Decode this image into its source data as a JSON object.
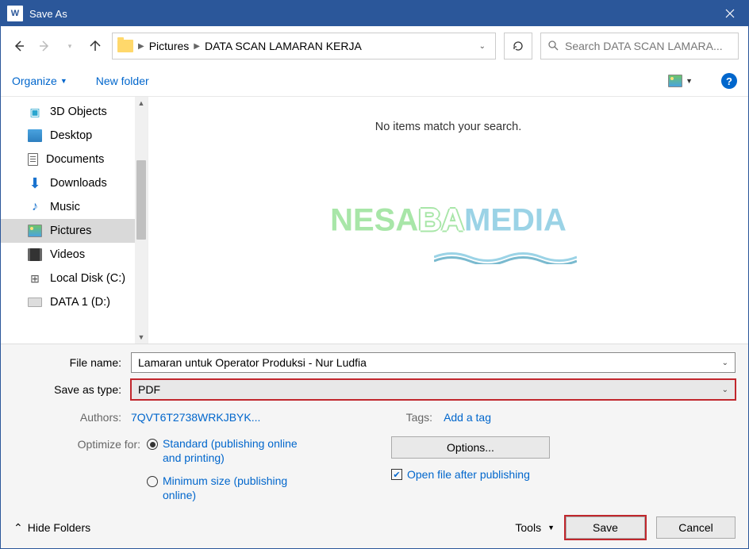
{
  "title": "Save As",
  "breadcrumbs": {
    "root": "Pictures",
    "current": "DATA SCAN LAMARAN KERJA"
  },
  "search": {
    "placeholder": "Search DATA SCAN LAMARA..."
  },
  "toolbar": {
    "organize": "Organize",
    "newfolder": "New folder"
  },
  "sidebar": {
    "items": [
      {
        "label": "3D Objects"
      },
      {
        "label": "Desktop"
      },
      {
        "label": "Documents"
      },
      {
        "label": "Downloads"
      },
      {
        "label": "Music"
      },
      {
        "label": "Pictures"
      },
      {
        "label": "Videos"
      },
      {
        "label": "Local Disk (C:)"
      },
      {
        "label": "DATA 1 (D:)"
      }
    ]
  },
  "filearea": {
    "empty_msg": "No items match your search."
  },
  "form": {
    "filename_label": "File name:",
    "filename_value": "Lamaran untuk Operator Produksi - Nur Ludfia",
    "savetype_label": "Save as type:",
    "savetype_value": "PDF",
    "authors_label": "Authors:",
    "authors_value": "7QVT6T2738WRKJBYK...",
    "tags_label": "Tags:",
    "tags_value": "Add a tag",
    "optimize_label": "Optimize for:",
    "opt_standard": "Standard (publishing online and printing)",
    "opt_min": "Minimum size (publishing online)",
    "options_btn": "Options...",
    "open_after": "Open file after publishing"
  },
  "footer": {
    "hide": "Hide Folders",
    "tools": "Tools",
    "save": "Save",
    "cancel": "Cancel"
  }
}
